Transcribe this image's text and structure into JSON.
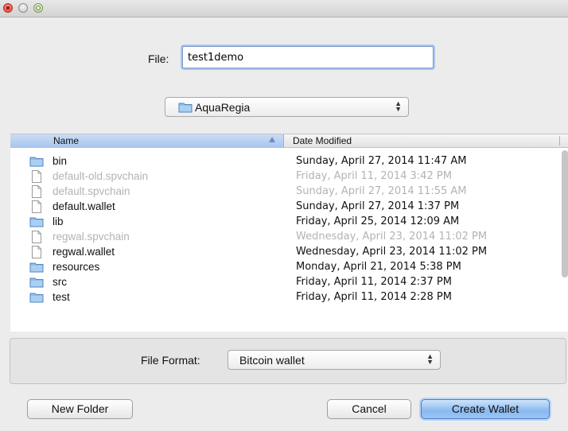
{
  "file_field": {
    "label": "File:",
    "value": "test1demo"
  },
  "location": {
    "selected": "AquaRegia"
  },
  "browser": {
    "columns": {
      "name": "Name",
      "date": "Date Modified"
    },
    "rows": [
      {
        "name": "bin",
        "date": "Sunday, April 27, 2014 11:47 AM",
        "type": "folder",
        "enabled": true
      },
      {
        "name": "default-old.spvchain",
        "date": "Friday, April 11, 2014 3:42 PM",
        "type": "file",
        "enabled": false
      },
      {
        "name": "default.spvchain",
        "date": "Sunday, April 27, 2014 11:55 AM",
        "type": "file",
        "enabled": false
      },
      {
        "name": "default.wallet",
        "date": "Sunday, April 27, 2014 1:37 PM",
        "type": "file",
        "enabled": true
      },
      {
        "name": "lib",
        "date": "Friday, April 25, 2014 12:09 AM",
        "type": "folder",
        "enabled": true
      },
      {
        "name": "regwal.spvchain",
        "date": "Wednesday, April 23, 2014 11:02 PM",
        "type": "file",
        "enabled": false
      },
      {
        "name": "regwal.wallet",
        "date": "Wednesday, April 23, 2014 11:02 PM",
        "type": "file",
        "enabled": true
      },
      {
        "name": "resources",
        "date": "Monday, April 21, 2014 5:38 PM",
        "type": "folder",
        "enabled": true
      },
      {
        "name": "src",
        "date": "Friday, April 11, 2014 2:37 PM",
        "type": "folder",
        "enabled": true
      },
      {
        "name": "test",
        "date": "Friday, April 11, 2014 2:28 PM",
        "type": "folder",
        "enabled": true
      }
    ]
  },
  "file_format": {
    "label": "File Format:",
    "selected": "Bitcoin wallet"
  },
  "buttons": {
    "new_folder": "New Folder",
    "cancel": "Cancel",
    "create": "Create Wallet"
  },
  "colors": {
    "accent": "#8ab9ef",
    "disabled_text": "#b3b3b3",
    "folder": "#7fb3e6"
  }
}
